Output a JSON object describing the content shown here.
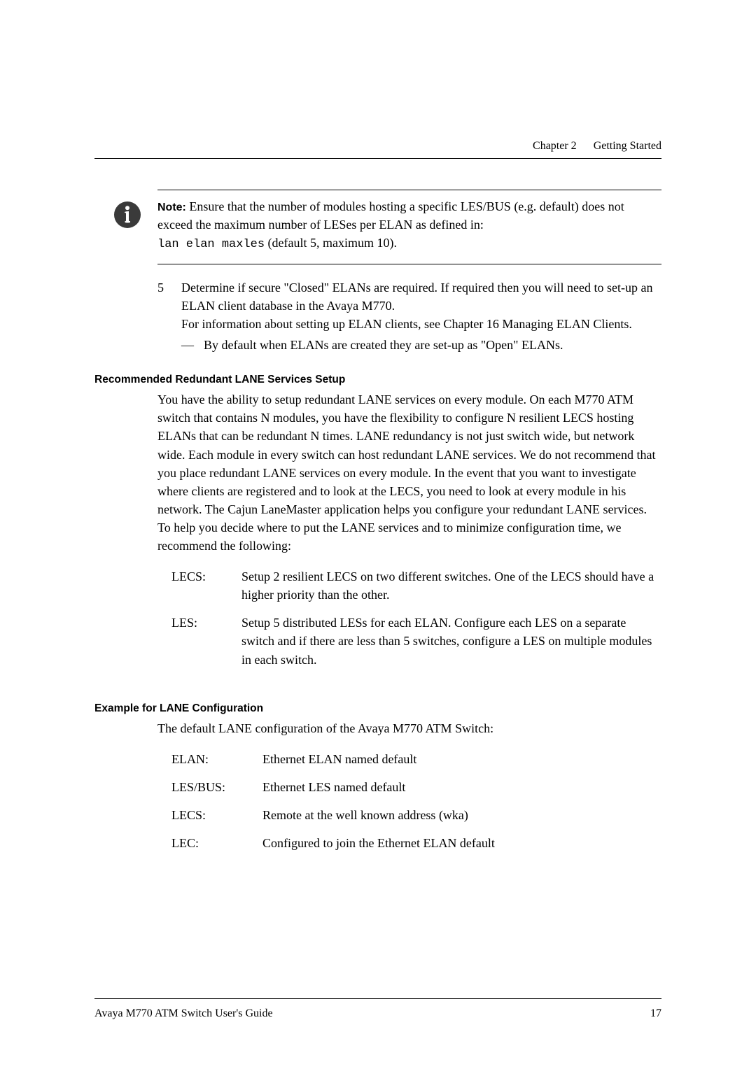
{
  "header": {
    "chapter": "Chapter 2",
    "title": "Getting Started"
  },
  "note": {
    "label": "Note:",
    "line1": "Ensure that the number of modules hosting a specific LES/BUS (e.g. default) does not exceed the maximum number of LESes per ELAN as defined in:",
    "code": "lan elan maxles",
    "line2": " (default 5, maximum 10)."
  },
  "step": {
    "num": "5",
    "body1": "Determine if secure \"Closed\" ELANs are required. If required then you will need to set-up an ELAN client database in the Avaya M770.",
    "body2": "For information about setting up ELAN clients, see Chapter 16 Managing ELAN Clients.",
    "bullet_dash": "—",
    "bullet_text": "By default when ELANs are created they are set-up as \"Open\" ELANs."
  },
  "sec1": {
    "heading": "Recommended Redundant LANE Services Setup",
    "para": "You have the ability to setup redundant LANE services on every module. On each M770 ATM switch that contains N modules, you have the flexibility to configure N resilient LECS hosting ELANs that can be redundant N times. LANE redundancy is not just switch wide, but network wide. Each module in every switch can host redundant LANE services. We do not recommend that you place redundant LANE services on every module. In the event that you want to investigate where clients are registered and to look at the LECS, you need to look at every module in his network. The Cajun LaneMaster application helps you configure your redundant LANE services. To help you decide where to put the LANE services and to minimize configuration time, we recommend the following:",
    "defs": [
      {
        "term": "LECS:",
        "body": "Setup 2 resilient LECS on two different switches. One of the LECS should have a higher priority than the other."
      },
      {
        "term": "LES:",
        "body": "Setup 5 distributed LESs for each ELAN. Configure each LES on a separate switch and if there are less than 5 switches, configure a LES on multiple modules in each switch."
      }
    ]
  },
  "sec2": {
    "heading": "Example for LANE Configuration",
    "para": "The default LANE configuration of the Avaya M770 ATM Switch:",
    "defs": [
      {
        "term": "ELAN:",
        "body": "Ethernet ELAN named default"
      },
      {
        "term": "LES/BUS:",
        "body": "Ethernet LES named default"
      },
      {
        "term": "LECS:",
        "body": "Remote at the well known address (wka)"
      },
      {
        "term": "LEC:",
        "body": "Configured to join the Ethernet ELAN default"
      }
    ]
  },
  "footer": {
    "left": "Avaya M770 ATM Switch User's Guide",
    "right": "17"
  }
}
